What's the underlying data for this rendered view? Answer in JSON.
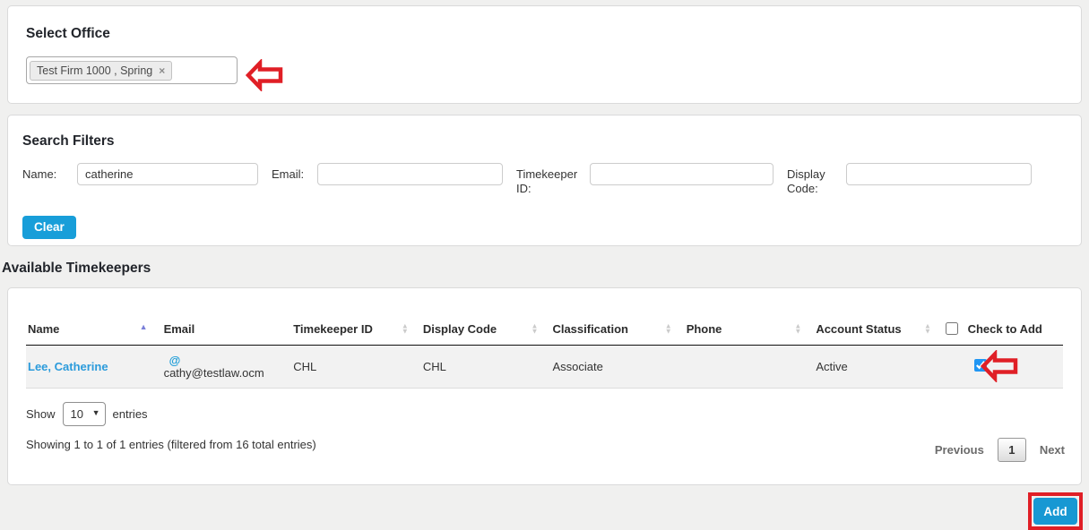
{
  "colors": {
    "accent_blue": "#189ed9",
    "annotation_red": "#e01f26",
    "link_blue": "#2b9bdb",
    "sort_active": "#7a7fd8",
    "page_background": "#f0f0ef"
  },
  "icons": {
    "remove": "×",
    "at": "@",
    "sort_up": "▲",
    "sort_down": "▼",
    "caret": "▼"
  },
  "select_office": {
    "title": "Select Office",
    "selected_tag": "Test Firm 1000 , Spring"
  },
  "search_filters": {
    "title": "Search Filters",
    "fields": [
      {
        "label": "Name:",
        "value": "catherine"
      },
      {
        "label": "Email:",
        "value": ""
      },
      {
        "label": "Timekeeper ID:",
        "value": ""
      },
      {
        "label": "Display Code:",
        "value": ""
      }
    ],
    "clear_button": "Clear"
  },
  "available_timekeepers": {
    "title": "Available Timekeepers",
    "table": {
      "columns": [
        {
          "label": "Name",
          "sort": "asc"
        },
        {
          "label": "Email",
          "sort": "none"
        },
        {
          "label": "Timekeeper ID",
          "sort": "both"
        },
        {
          "label": "Display Code",
          "sort": "both"
        },
        {
          "label": "Classification",
          "sort": "both"
        },
        {
          "label": "Phone",
          "sort": "both"
        },
        {
          "label": "Account Status",
          "sort": "both"
        },
        {
          "label": "Check to Add",
          "sort": "none"
        }
      ],
      "rows": [
        {
          "name": "Lee, Catherine",
          "email": "cathy@testlaw.ocm",
          "timekeeper_id": "CHL",
          "display_code": "CHL",
          "classification": "Associate",
          "phone": "",
          "account_status": "Active",
          "checked_attr": "checked"
        }
      ]
    },
    "show_label": "Show",
    "page_size": "10",
    "entries_label": "entries",
    "status_text": "Showing 1 to 1 of 1 entries (filtered from 16 total entries)",
    "pagination": {
      "previous": "Previous",
      "current_page": "1",
      "next": "Next"
    }
  },
  "footer": {
    "add_button": "Add"
  }
}
